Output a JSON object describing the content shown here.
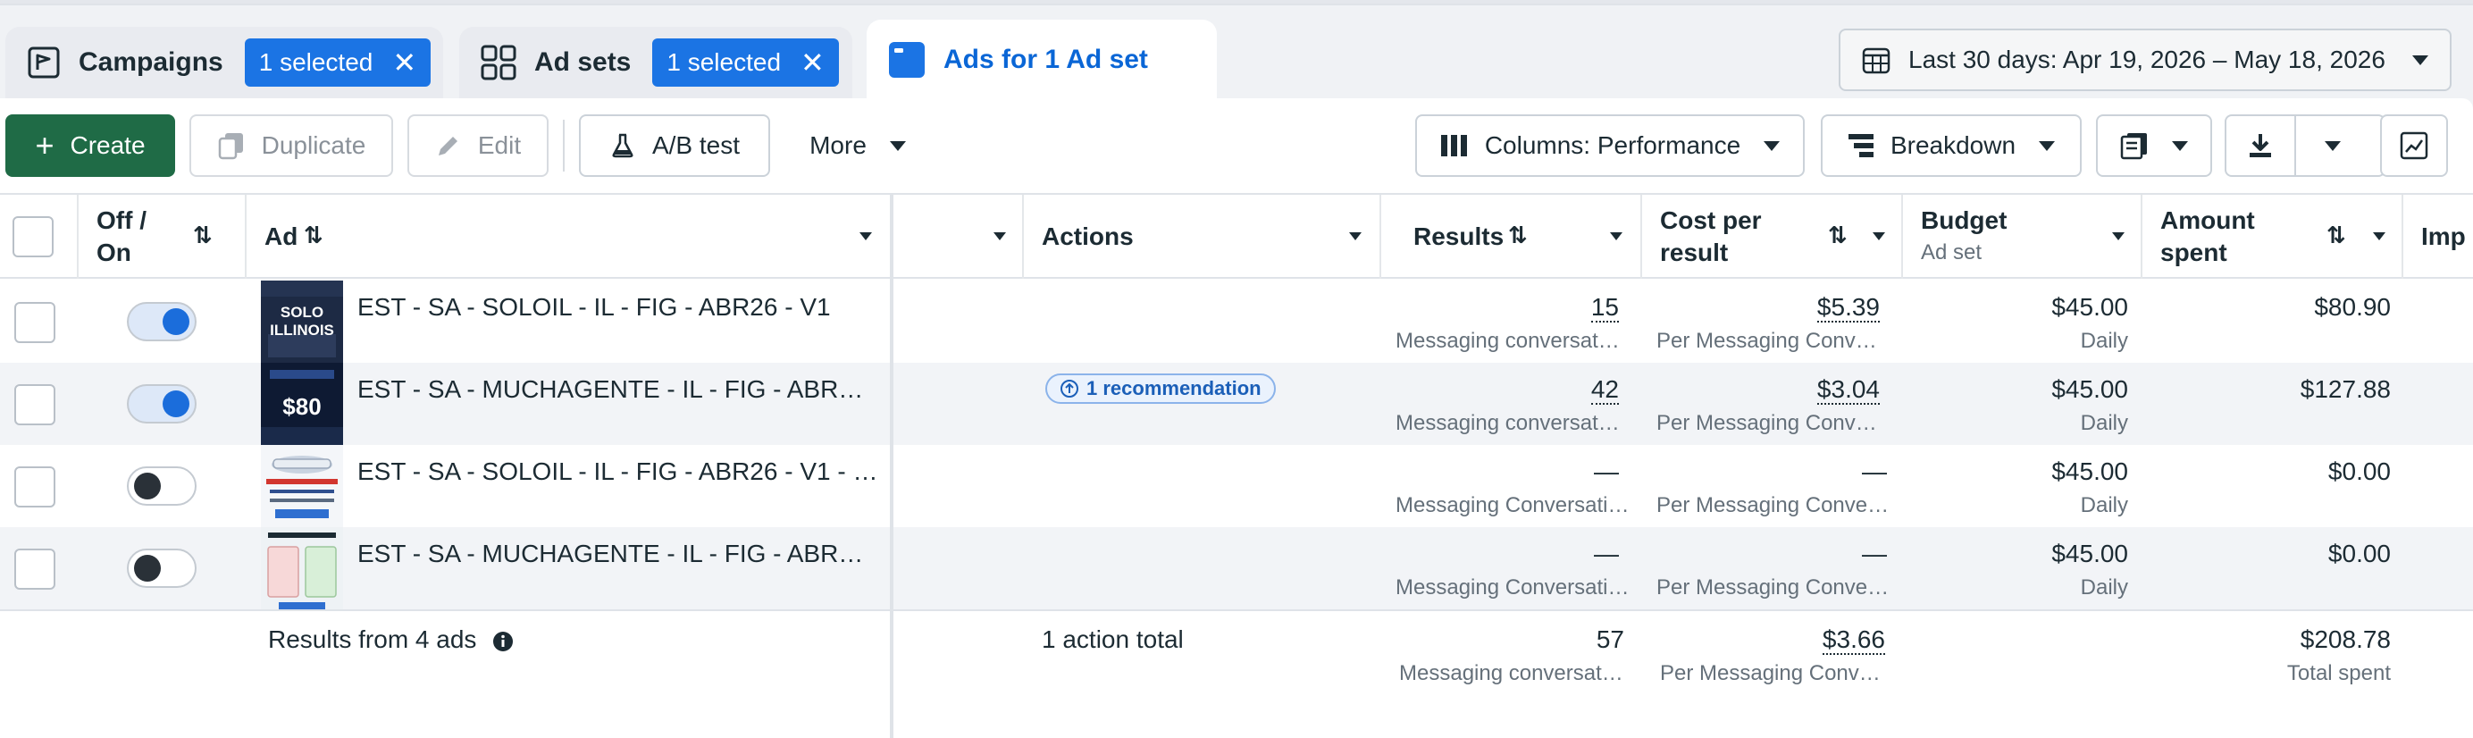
{
  "tabs": {
    "campaigns": {
      "label": "Campaigns",
      "badge": "1 selected",
      "close": "✕"
    },
    "adsets": {
      "label": "Ad sets",
      "badge": "1 selected",
      "close": "✕"
    },
    "ads": {
      "label": "Ads for 1 Ad set"
    }
  },
  "date_range": "Last 30 days: Apr 19, 2026 – May 18, 2026",
  "toolbar": {
    "create": "Create",
    "duplicate": "Duplicate",
    "edit": "Edit",
    "ab_test": "A/B test",
    "more": "More",
    "columns": "Columns: Performance",
    "breakdown": "Breakdown"
  },
  "headers": {
    "off_on": "Off / On",
    "ad": "Ad",
    "actions": "Actions",
    "results": "Results",
    "cost_per_result": "Cost per result",
    "budget": "Budget",
    "budget_sub": "Ad set",
    "amount_spent": "Amount spent",
    "impressions": "Imp"
  },
  "rows": [
    {
      "name": "EST - SA - SOLOIL - IL - FIG - ABR26 - V1",
      "toggle": "on",
      "action": "",
      "results": "15",
      "results_sub": "Messaging conversat…",
      "cost": "$5.39",
      "cost_sub": "Per Messaging Conv…",
      "budget": "$45.00",
      "budget_sub": "Daily",
      "spent": "$80.90",
      "thumb_text": "SOLO ILLINOIS"
    },
    {
      "name": "EST - SA - MUCHAGENTE - IL - FIG - ABR…",
      "toggle": "on",
      "action": "1 recommendation",
      "results": "42",
      "results_sub": "Messaging conversat…",
      "cost": "$3.04",
      "cost_sub": "Per Messaging Conv…",
      "budget": "$45.00",
      "budget_sub": "Daily",
      "spent": "$127.88",
      "thumb_text": "$80"
    },
    {
      "name": "EST - SA - SOLOIL - IL - FIG - ABR26 - V1 - …",
      "toggle": "off",
      "action": "",
      "results": "—",
      "results_sub": "Messaging Conversati…",
      "cost": "—",
      "cost_sub": "Per Messaging Conve…",
      "budget": "$45.00",
      "budget_sub": "Daily",
      "spent": "$0.00",
      "thumb_text": ""
    },
    {
      "name": "EST - SA - MUCHAGENTE - IL - FIG - ABR…",
      "toggle": "off",
      "action": "",
      "results": "—",
      "results_sub": "Messaging Conversati…",
      "cost": "—",
      "cost_sub": "Per Messaging Conve…",
      "budget": "$45.00",
      "budget_sub": "Daily",
      "spent": "$0.00",
      "thumb_text": ""
    }
  ],
  "footer": {
    "label": "Results from 4 ads",
    "actions_total": "1 action total",
    "results": "57",
    "results_sub": "Messaging conversat…",
    "cost": "$3.66",
    "cost_sub": "Per Messaging Conv…",
    "spent": "$208.78",
    "spent_sub": "Total spent"
  },
  "colors": {
    "primary_green": "#1f6b46",
    "accent_blue": "#1b74e4",
    "active_tab_text": "#0a66d6"
  }
}
